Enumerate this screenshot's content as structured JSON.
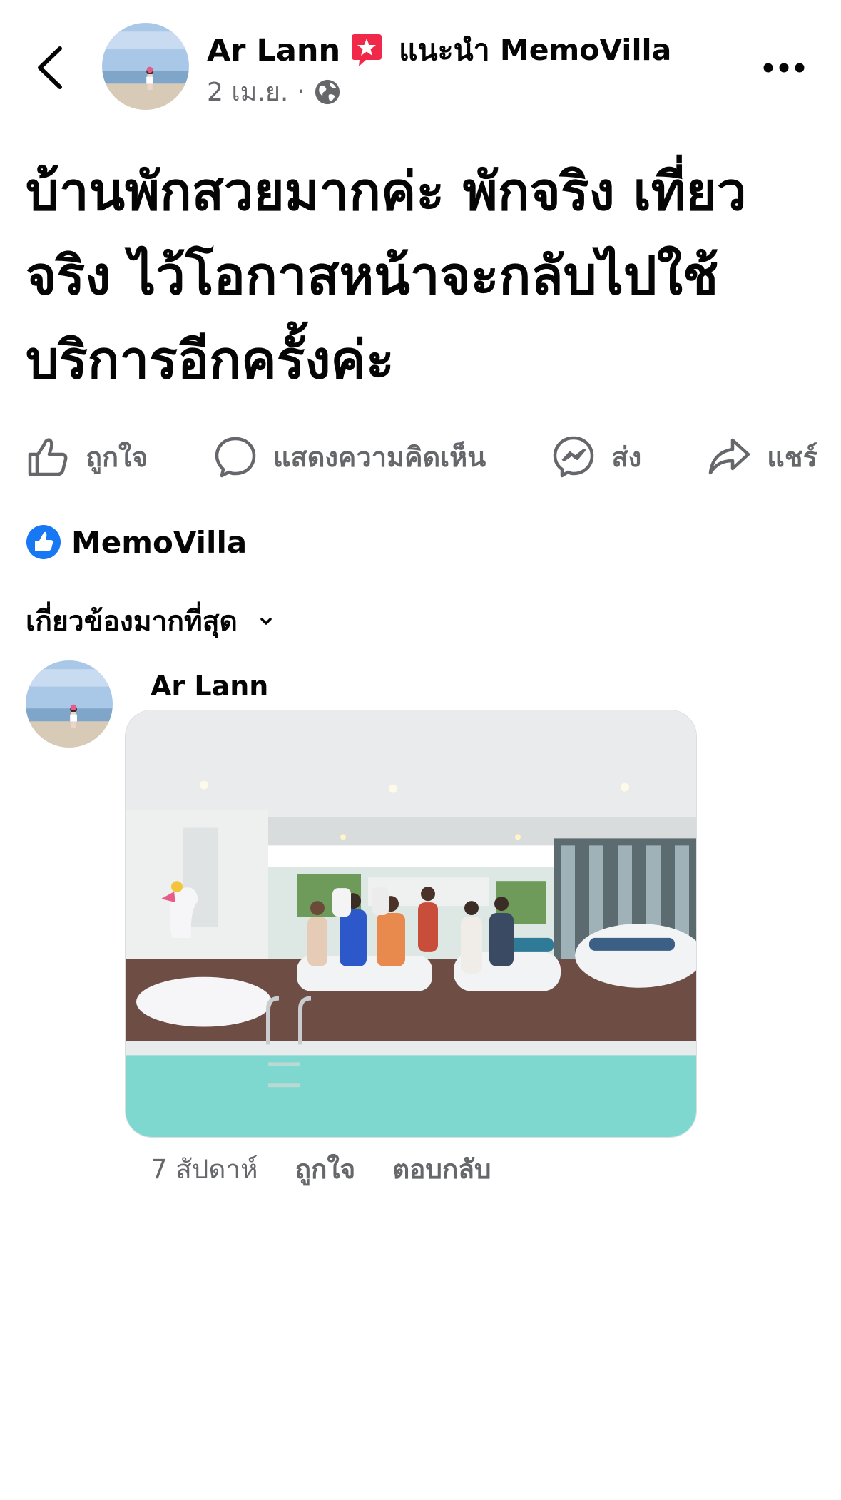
{
  "header": {
    "author_name": "Ar Lann",
    "recommends_text": "แนะนำ MemoVilla",
    "timestamp": "2 เม.ย.",
    "separator": "·",
    "privacy_icon": "globe-icon",
    "badge_icon": "recommend-badge-icon",
    "back_icon": "chevron-left-icon",
    "more_icon": "more-icon"
  },
  "post": {
    "text": "บ้านพักสวยมากค่ะ  พักจริง เที่ยวจริง ไว้โอกาสหน้าจะกลับไปใช้บริการอีกครั้งค่ะ"
  },
  "actions": {
    "like": "ถูกใจ",
    "comment": "แสดงความคิดเห็น",
    "send": "ส่ง",
    "share": "แชร์"
  },
  "reactions": {
    "liked_by": "MemoVilla",
    "icon": "like-badge-icon"
  },
  "comments": {
    "sort_label": "เกี่ยวข้องมากที่สุด",
    "items": [
      {
        "author": "Ar Lann",
        "age": "7 สัปดาห์",
        "like_label": "ถูกใจ",
        "reply_label": "ตอบกลับ"
      }
    ]
  },
  "colors": {
    "accent_blue": "#1877f2",
    "secondary_text": "#65676b",
    "badge_red": "#f02849",
    "pool": "#6fd3c9"
  }
}
